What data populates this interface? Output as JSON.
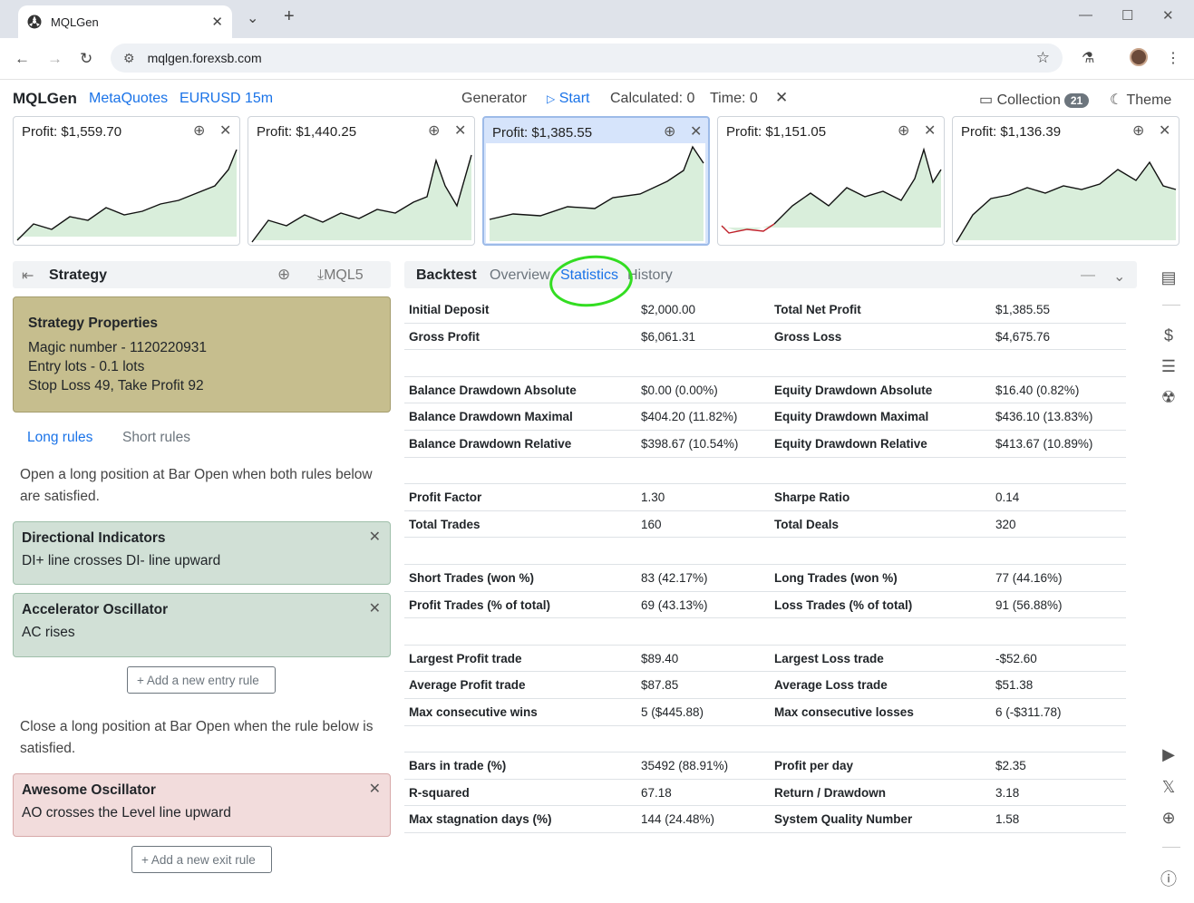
{
  "browser": {
    "tab_title": "MQLGen",
    "url": "mqlgen.forexsb.com"
  },
  "app": {
    "brand": "MQLGen",
    "server": "MetaQuotes",
    "symbol": "EURUSD",
    "period": "15m",
    "generator_label": "Generator",
    "start_label": "Start",
    "calculated": "Calculated: 0",
    "time": "Time: 0",
    "collection_label": "Collection",
    "collection_count": "21",
    "theme_label": "Theme"
  },
  "cards": [
    {
      "profit": "Profit: $1,559.70"
    },
    {
      "profit": "Profit: $1,440.25"
    },
    {
      "profit": "Profit: $1,385.55"
    },
    {
      "profit": "Profit: $1,151.05"
    },
    {
      "profit": "Profit: $1,136.39"
    }
  ],
  "strategy": {
    "title": "Strategy",
    "mql5_label": "MQL5",
    "props_title": "Strategy Properties",
    "magic": "Magic number - 1120220931",
    "lots": "Entry lots - 0.1 lots",
    "sltp": "Stop Loss 49, Take Profit 92",
    "tab_long": "Long rules",
    "tab_short": "Short rules",
    "entry_desc": "Open a long position at Bar Open when both rules below are satisfied.",
    "rules_entry": [
      {
        "title": "Directional Indicators",
        "text": "DI+ line crosses DI- line upward"
      },
      {
        "title": "Accelerator Oscillator",
        "text": "AC rises"
      }
    ],
    "add_entry": "+ Add a new entry rule",
    "exit_desc": "Close a long position at Bar Open when the rule below is satisfied.",
    "rules_exit": [
      {
        "title": "Awesome Oscillator",
        "text": "AO crosses the Level line upward"
      }
    ],
    "add_exit": "+ Add a new exit rule"
  },
  "backtest": {
    "tabs": [
      "Backtest",
      "Overview",
      "Statistics",
      "History"
    ],
    "rows": [
      [
        "Initial Deposit",
        "$2,000.00",
        "Total Net Profit",
        "$1,385.55"
      ],
      [
        "Gross Profit",
        "$6,061.31",
        "Gross Loss",
        "$4,675.76"
      ],
      [
        "",
        "",
        "",
        ""
      ],
      [
        "Balance Drawdown Absolute",
        "$0.00 (0.00%)",
        "Equity Drawdown Absolute",
        "$16.40 (0.82%)"
      ],
      [
        "Balance Drawdown Maximal",
        "$404.20 (11.82%)",
        "Equity Drawdown Maximal",
        "$436.10 (13.83%)"
      ],
      [
        "Balance Drawdown Relative",
        "$398.67 (10.54%)",
        "Equity Drawdown Relative",
        "$413.67 (10.89%)"
      ],
      [
        "",
        "",
        "",
        ""
      ],
      [
        "Profit Factor",
        "1.30",
        "Sharpe Ratio",
        "0.14"
      ],
      [
        "Total Trades",
        "160",
        "Total Deals",
        "320"
      ],
      [
        "",
        "",
        "",
        ""
      ],
      [
        "Short Trades (won %)",
        "83 (42.17%)",
        "Long Trades (won %)",
        "77 (44.16%)"
      ],
      [
        "Profit Trades (% of total)",
        "69 (43.13%)",
        "Loss Trades (% of total)",
        "91 (56.88%)"
      ],
      [
        "",
        "",
        "",
        ""
      ],
      [
        "Largest Profit trade",
        "$89.40",
        "Largest Loss trade",
        "-$52.60"
      ],
      [
        "Average Profit trade",
        "$87.85",
        "Average Loss trade",
        "$51.38"
      ],
      [
        "Max consecutive wins",
        "5 ($445.88)",
        "Max consecutive losses",
        "6 (-$311.78)"
      ],
      [
        "",
        "",
        "",
        ""
      ],
      [
        "Bars in trade (%)",
        "35492 (88.91%)",
        "Profit per day",
        "$2.35"
      ],
      [
        "R-squared",
        "67.18",
        "Return / Drawdown",
        "3.18"
      ],
      [
        "Max stagnation days (%)",
        "144 (24.48%)",
        "System Quality Number",
        "1.58"
      ]
    ]
  },
  "colors": {
    "accent": "#1a73e8",
    "props_bg": "#c6be8e",
    "entry_rule_bg": "#d1e0d6",
    "exit_rule_bg": "#f2dcdc",
    "selected_card_bg": "#d6e4fb",
    "annotation_circle": "#33dd22"
  }
}
